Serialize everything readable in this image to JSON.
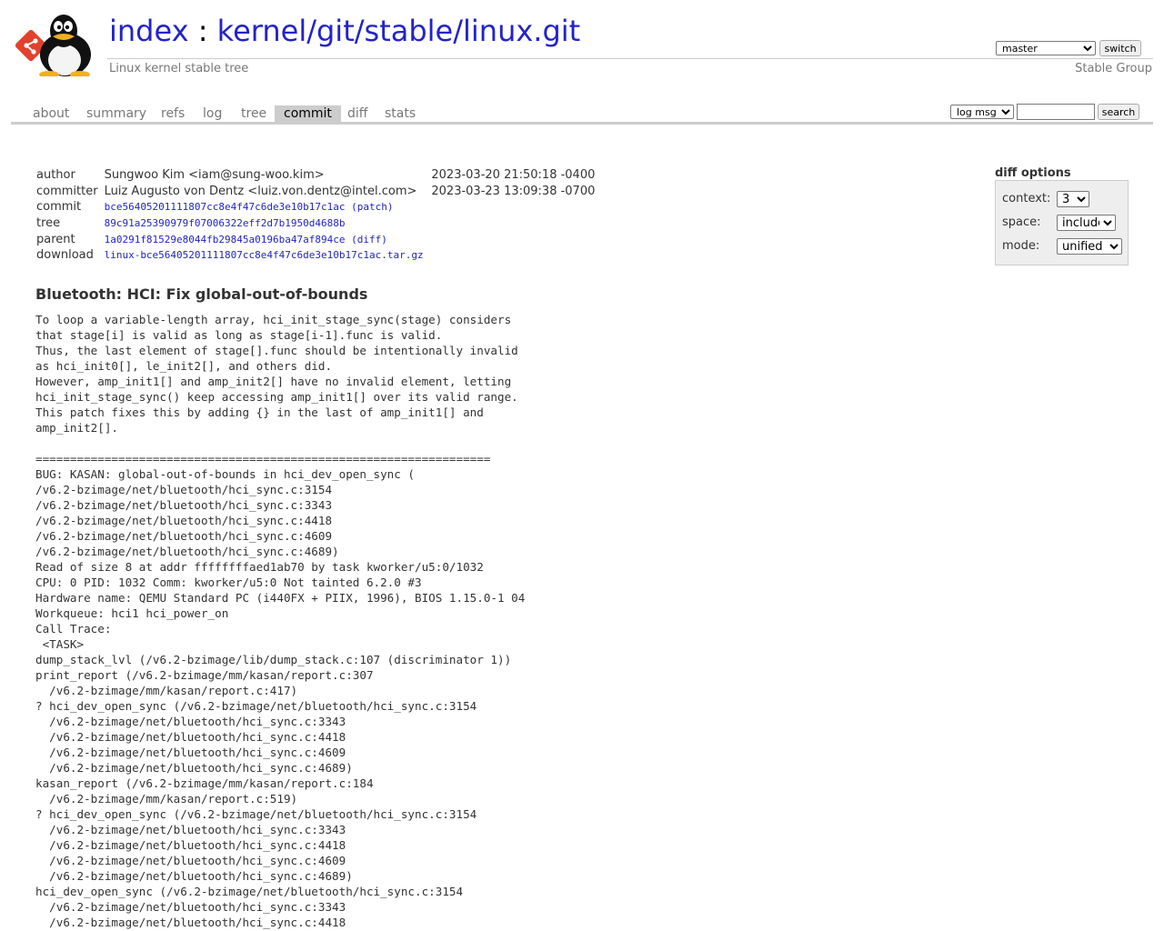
{
  "header": {
    "title_prefix": "index",
    "title_separator": " : ",
    "repo_path": "kernel/git/stable/linux.git",
    "description": "Linux kernel stable tree",
    "owner": "Stable Group",
    "branch_select": {
      "selected": "master"
    },
    "switch_label": "switch"
  },
  "tabs": [
    {
      "label": "about",
      "active": false
    },
    {
      "label": "summary",
      "active": false
    },
    {
      "label": "refs",
      "active": false
    },
    {
      "label": "log",
      "active": false
    },
    {
      "label": "tree",
      "active": false
    },
    {
      "label": "commit",
      "active": true
    },
    {
      "label": "diff",
      "active": false
    },
    {
      "label": "stats",
      "active": false
    }
  ],
  "search": {
    "scope_selected": "log msg",
    "query": "",
    "button_label": "search"
  },
  "commit_info": {
    "author_label": "author",
    "author": "Sungwoo Kim <iam@sung-woo.kim>",
    "author_date": "2023-03-20 21:50:18 -0400",
    "committer_label": "committer",
    "committer": "Luiz Augusto von Dentz <luiz.von.dentz@intel.com>",
    "committer_date": "2023-03-23 13:09:38 -0700",
    "commit_label": "commit",
    "commit_hash": "bce56405201111807cc8e4f47c6de3e10b17c1ac",
    "commit_link": "(patch)",
    "tree_label": "tree",
    "tree_hash": "89c91a25390979f07006322eff2d7b1950d4688b",
    "parent_label": "parent",
    "parent_hash": "1a0291f81529e8044fb29845a0196ba47af894ce",
    "parent_link": "(diff)",
    "download_label": "download",
    "download_file": "linux-bce56405201111807cc8e4f47c6de3e10b17c1ac.tar.gz"
  },
  "diff_options": {
    "title": "diff options",
    "context_label": "context:",
    "context_value": "3",
    "space_label": "space:",
    "space_value": "include",
    "mode_label": "mode:",
    "mode_value": "unified"
  },
  "message": {
    "subject": "Bluetooth: HCI: Fix global-out-of-bounds",
    "body": "To loop a variable-length array, hci_init_stage_sync(stage) considers\nthat stage[i] is valid as long as stage[i-1].func is valid.\nThus, the last element of stage[].func should be intentionally invalid\nas hci_init0[], le_init2[], and others did.\nHowever, amp_init1[] and amp_init2[] have no invalid element, letting\nhci_init_stage_sync() keep accessing amp_init1[] over its valid range.\nThis patch fixes this by adding {} in the last of amp_init1[] and\namp_init2[].\n\n==================================================================\nBUG: KASAN: global-out-of-bounds in hci_dev_open_sync (\n/v6.2-bzimage/net/bluetooth/hci_sync.c:3154\n/v6.2-bzimage/net/bluetooth/hci_sync.c:3343\n/v6.2-bzimage/net/bluetooth/hci_sync.c:4418\n/v6.2-bzimage/net/bluetooth/hci_sync.c:4609\n/v6.2-bzimage/net/bluetooth/hci_sync.c:4689)\nRead of size 8 at addr ffffffffaed1ab70 by task kworker/u5:0/1032\nCPU: 0 PID: 1032 Comm: kworker/u5:0 Not tainted 6.2.0 #3\nHardware name: QEMU Standard PC (i440FX + PIIX, 1996), BIOS 1.15.0-1 04\nWorkqueue: hci1 hci_power_on\nCall Trace:\n <TASK>\ndump_stack_lvl (/v6.2-bzimage/lib/dump_stack.c:107 (discriminator 1))\nprint_report (/v6.2-bzimage/mm/kasan/report.c:307\n  /v6.2-bzimage/mm/kasan/report.c:417)\n? hci_dev_open_sync (/v6.2-bzimage/net/bluetooth/hci_sync.c:3154\n  /v6.2-bzimage/net/bluetooth/hci_sync.c:3343\n  /v6.2-bzimage/net/bluetooth/hci_sync.c:4418\n  /v6.2-bzimage/net/bluetooth/hci_sync.c:4609\n  /v6.2-bzimage/net/bluetooth/hci_sync.c:4689)\nkasan_report (/v6.2-bzimage/mm/kasan/report.c:184\n  /v6.2-bzimage/mm/kasan/report.c:519)\n? hci_dev_open_sync (/v6.2-bzimage/net/bluetooth/hci_sync.c:3154\n  /v6.2-bzimage/net/bluetooth/hci_sync.c:3343\n  /v6.2-bzimage/net/bluetooth/hci_sync.c:4418\n  /v6.2-bzimage/net/bluetooth/hci_sync.c:4609\n  /v6.2-bzimage/net/bluetooth/hci_sync.c:4689)\nhci_dev_open_sync (/v6.2-bzimage/net/bluetooth/hci_sync.c:3154\n  /v6.2-bzimage/net/bluetooth/hci_sync.c:3343\n  /v6.2-bzimage/net/bluetooth/hci_sync.c:4418"
  }
}
